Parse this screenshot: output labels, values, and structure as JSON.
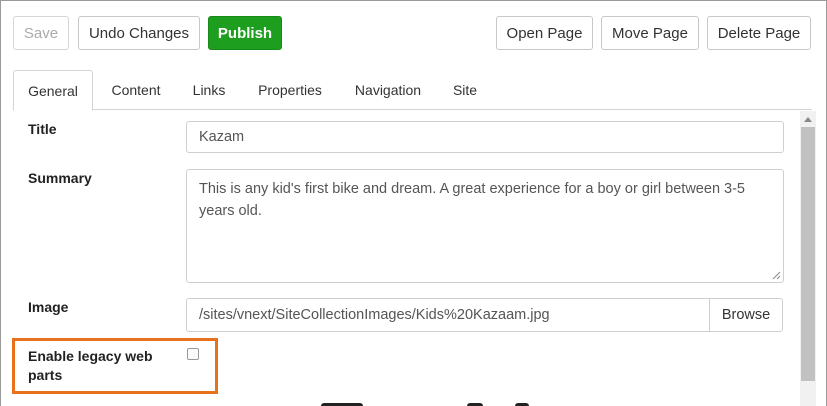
{
  "toolbar": {
    "save_label": "Save",
    "undo_label": "Undo Changes",
    "publish_label": "Publish",
    "open_page_label": "Open Page",
    "move_page_label": "Move Page",
    "delete_page_label": "Delete Page"
  },
  "tabs": [
    {
      "label": "General",
      "active": true
    },
    {
      "label": "Content",
      "active": false
    },
    {
      "label": "Links",
      "active": false
    },
    {
      "label": "Properties",
      "active": false
    },
    {
      "label": "Navigation",
      "active": false
    },
    {
      "label": "Site",
      "active": false
    }
  ],
  "form": {
    "title_label": "Title",
    "title_value": "Kazam",
    "summary_label": "Summary",
    "summary_value": "This is any kid's first bike and dream. A great experience for a boy or girl between 3-5 years old.",
    "image_label": "Image",
    "image_value": "/sites/vnext/SiteCollectionImages/Kids%20Kazaam.jpg",
    "browse_label": "Browse",
    "legacy_label": "Enable legacy web parts",
    "legacy_checked": false
  },
  "colors": {
    "publish": "#1e9e1e",
    "highlight": "#e8711d"
  }
}
